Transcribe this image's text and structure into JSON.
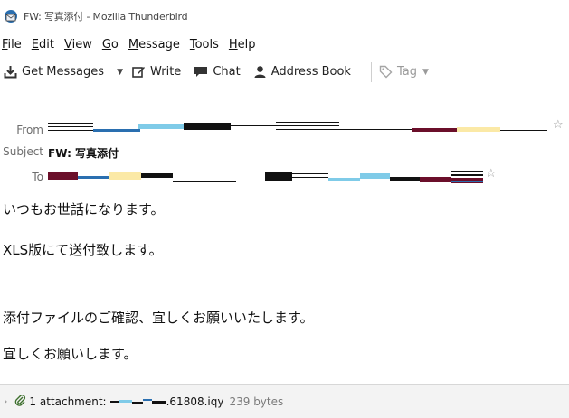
{
  "window": {
    "title": "FW: 写真添付 - Mozilla Thunderbird"
  },
  "menu": [
    {
      "label": "File",
      "key": "F",
      "rest": "ile"
    },
    {
      "label": "Edit",
      "key": "E",
      "rest": "dit"
    },
    {
      "label": "View",
      "key": "V",
      "rest": "iew"
    },
    {
      "label": "Go",
      "key": "G",
      "rest": "o"
    },
    {
      "label": "Message",
      "key": "M",
      "rest": "essage"
    },
    {
      "label": "Tools",
      "key": "T",
      "rest": "ools"
    },
    {
      "label": "Help",
      "key": "H",
      "rest": "elp"
    }
  ],
  "toolbar": {
    "get_messages": "Get Messages",
    "write": "Write",
    "chat": "Chat",
    "address_book": "Address Book",
    "tag": "Tag"
  },
  "header": {
    "from_label": "From",
    "subject_label": "Subject",
    "subject_value": "FW: 写真添付",
    "to_label": "To"
  },
  "body": {
    "line1": "いつもお世話になります。",
    "line2": "XLS版にて送付致します。",
    "line3": "添付ファイルのご確認、宜しくお願いいたします。",
    "line4": "宜しくお願いします。"
  },
  "attachment": {
    "label_prefix": "1 attachment:",
    "filename_suffix": ".61808.iqy",
    "size": "239 bytes"
  },
  "colors": {
    "accent": "#2a6fb0",
    "redact_dark": "#111111",
    "redact_maroon": "#6b0f2a",
    "redact_blue": "#7fcbe8",
    "redact_yellow": "#fbe9a6"
  }
}
